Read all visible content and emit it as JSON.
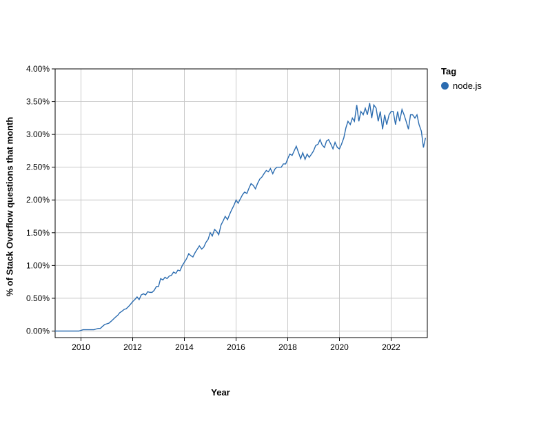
{
  "chart_data": {
    "type": "line",
    "title": "",
    "xlabel": "Year",
    "ylabel": "% of Stack Overflow questions that month",
    "x_start": 2009.0,
    "x_end": 2023.4,
    "x_ticks": [
      2010,
      2012,
      2014,
      2016,
      2018,
      2020,
      2022
    ],
    "y_ticks": [
      0.0,
      0.5,
      1.0,
      1.5,
      2.0,
      2.5,
      3.0,
      3.5,
      4.0
    ],
    "y_tick_labels": [
      "0.00%",
      "0.50%",
      "1.00%",
      "1.50%",
      "2.00%",
      "2.50%",
      "3.00%",
      "3.50%",
      "4.00%"
    ],
    "ylim": [
      -0.1,
      4.0
    ],
    "legend_title": "Tag",
    "series": [
      {
        "name": "node.js",
        "color": "#2b6cb0",
        "x": [
          2009.0,
          2009.08,
          2009.17,
          2009.25,
          2009.33,
          2009.42,
          2009.5,
          2009.58,
          2009.67,
          2009.75,
          2009.83,
          2009.92,
          2010.0,
          2010.08,
          2010.17,
          2010.25,
          2010.33,
          2010.42,
          2010.5,
          2010.58,
          2010.67,
          2010.75,
          2010.83,
          2010.92,
          2011.0,
          2011.08,
          2011.17,
          2011.25,
          2011.33,
          2011.42,
          2011.5,
          2011.58,
          2011.67,
          2011.75,
          2011.83,
          2011.92,
          2012.0,
          2012.08,
          2012.17,
          2012.25,
          2012.33,
          2012.42,
          2012.5,
          2012.58,
          2012.67,
          2012.75,
          2012.83,
          2012.92,
          2013.0,
          2013.08,
          2013.17,
          2013.25,
          2013.33,
          2013.42,
          2013.5,
          2013.58,
          2013.67,
          2013.75,
          2013.83,
          2013.92,
          2014.0,
          2014.08,
          2014.17,
          2014.25,
          2014.33,
          2014.42,
          2014.5,
          2014.58,
          2014.67,
          2014.75,
          2014.83,
          2014.92,
          2015.0,
          2015.08,
          2015.17,
          2015.25,
          2015.33,
          2015.42,
          2015.5,
          2015.58,
          2015.67,
          2015.75,
          2015.83,
          2015.92,
          2016.0,
          2016.08,
          2016.17,
          2016.25,
          2016.33,
          2016.42,
          2016.5,
          2016.58,
          2016.67,
          2016.75,
          2016.83,
          2016.92,
          2017.0,
          2017.08,
          2017.17,
          2017.25,
          2017.33,
          2017.42,
          2017.5,
          2017.58,
          2017.67,
          2017.75,
          2017.83,
          2017.92,
          2018.0,
          2018.08,
          2018.17,
          2018.25,
          2018.33,
          2018.42,
          2018.5,
          2018.58,
          2018.67,
          2018.75,
          2018.83,
          2018.92,
          2019.0,
          2019.08,
          2019.17,
          2019.25,
          2019.33,
          2019.42,
          2019.5,
          2019.58,
          2019.67,
          2019.75,
          2019.83,
          2019.92,
          2020.0,
          2020.08,
          2020.17,
          2020.25,
          2020.33,
          2020.42,
          2020.5,
          2020.58,
          2020.67,
          2020.75,
          2020.83,
          2020.92,
          2021.0,
          2021.08,
          2021.17,
          2021.25,
          2021.33,
          2021.42,
          2021.5,
          2021.58,
          2021.67,
          2021.75,
          2021.83,
          2021.92,
          2022.0,
          2022.08,
          2022.17,
          2022.25,
          2022.33,
          2022.42,
          2022.5,
          2022.58,
          2022.67,
          2022.75,
          2022.83,
          2022.92,
          2023.0,
          2023.08,
          2023.17,
          2023.25,
          2023.33
        ],
        "y": [
          0.0,
          0.0,
          0.0,
          0.0,
          0.0,
          0.0,
          0.0,
          0.0,
          0.0,
          0.0,
          0.0,
          0.0,
          0.01,
          0.02,
          0.02,
          0.02,
          0.02,
          0.02,
          0.02,
          0.03,
          0.04,
          0.04,
          0.07,
          0.1,
          0.11,
          0.12,
          0.15,
          0.18,
          0.21,
          0.24,
          0.28,
          0.3,
          0.33,
          0.34,
          0.37,
          0.41,
          0.45,
          0.48,
          0.52,
          0.48,
          0.55,
          0.57,
          0.55,
          0.6,
          0.59,
          0.59,
          0.62,
          0.68,
          0.68,
          0.8,
          0.78,
          0.82,
          0.8,
          0.84,
          0.85,
          0.9,
          0.88,
          0.93,
          0.92,
          1.0,
          1.05,
          1.1,
          1.18,
          1.15,
          1.13,
          1.2,
          1.25,
          1.3,
          1.25,
          1.28,
          1.35,
          1.4,
          1.5,
          1.45,
          1.55,
          1.52,
          1.47,
          1.62,
          1.68,
          1.75,
          1.7,
          1.78,
          1.85,
          1.92,
          2.0,
          1.95,
          2.02,
          2.08,
          2.12,
          2.1,
          2.18,
          2.25,
          2.22,
          2.17,
          2.25,
          2.32,
          2.35,
          2.4,
          2.45,
          2.43,
          2.48,
          2.4,
          2.47,
          2.5,
          2.5,
          2.5,
          2.55,
          2.55,
          2.63,
          2.7,
          2.68,
          2.75,
          2.82,
          2.72,
          2.63,
          2.72,
          2.62,
          2.7,
          2.65,
          2.7,
          2.75,
          2.83,
          2.85,
          2.92,
          2.84,
          2.8,
          2.9,
          2.92,
          2.85,
          2.78,
          2.88,
          2.8,
          2.78,
          2.85,
          2.95,
          3.1,
          3.2,
          3.15,
          3.25,
          3.2,
          3.45,
          3.2,
          3.35,
          3.3,
          3.4,
          3.3,
          3.48,
          3.25,
          3.45,
          3.4,
          3.2,
          3.35,
          3.08,
          3.3,
          3.15,
          3.3,
          3.35,
          3.35,
          3.15,
          3.35,
          3.2,
          3.38,
          3.3,
          3.2,
          3.08,
          3.3,
          3.3,
          3.25,
          3.3,
          3.15,
          3.05,
          2.8,
          2.95
        ]
      }
    ]
  }
}
